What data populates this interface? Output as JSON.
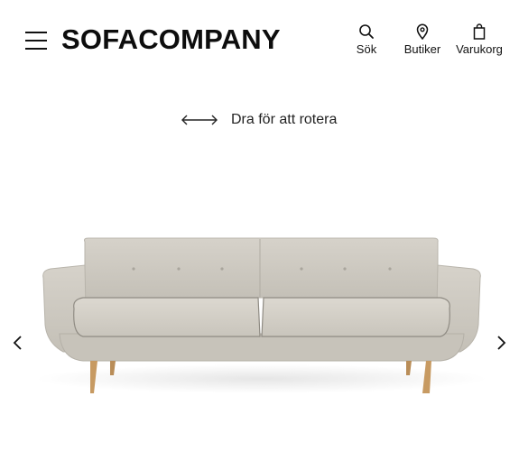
{
  "header": {
    "logo": "SOFACOMPANY",
    "menu_icon": "hamburger-menu-icon",
    "nav": [
      {
        "label": "Sök",
        "icon": "search-icon"
      },
      {
        "label": "Butiker",
        "icon": "map-pin-icon"
      },
      {
        "label": "Varukorg",
        "icon": "shopping-bag-icon"
      }
    ]
  },
  "viewer": {
    "hint": "Dra för att rotera",
    "hint_icon": "double-arrow-icon",
    "prev_icon": "chevron-left-icon",
    "next_icon": "chevron-right-icon"
  },
  "colors": {
    "text": "#111111",
    "fabric": "#cfcbc3",
    "legs": "#c9a06a"
  }
}
